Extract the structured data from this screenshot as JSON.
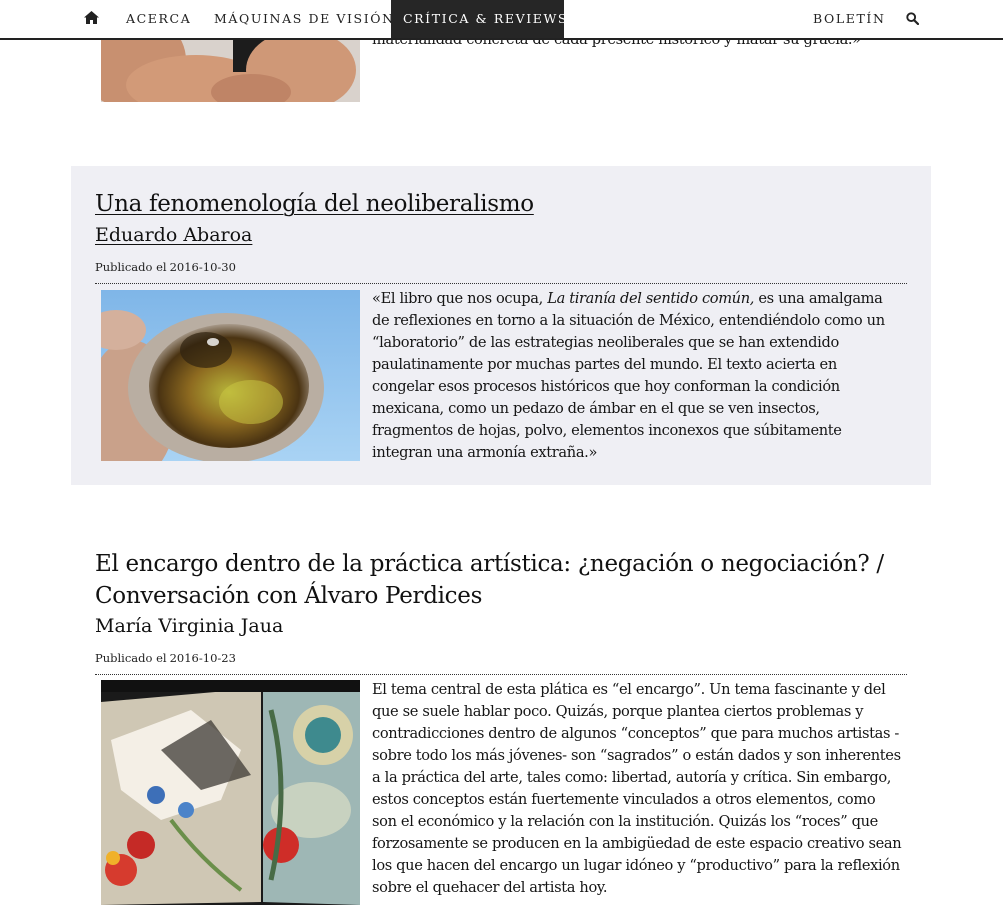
{
  "nav": {
    "items": [
      {
        "label": "ACERCA"
      },
      {
        "label": "MÁQUINAS DE VISIÓN"
      },
      {
        "label": "CRÍTICA & REVIEWS"
      },
      {
        "label": "BOLETÍN"
      }
    ],
    "home_icon": "home-icon",
    "search_icon": "search-icon",
    "active_label": "CRÍTICA & REVIEWS"
  },
  "previous_excerpt": {
    "tail_text": "materialidad concreta de cada presente histórico y matar su gracia.»"
  },
  "articles": [
    {
      "title": "Una fenomenología del neoliberalismo",
      "author": "Eduardo Abaroa",
      "published_prefix": "Publicado el",
      "published_date": "2016-10-30",
      "excerpt_before": "«El libro que nos ocupa, ",
      "excerpt_italic": "La tiranía del sentido común,",
      "excerpt_after": " es una amalgama de reflexiones en torno a la situación de México, entendiéndolo como un “laboratorio” de las estrategias neoliberales que se han extendido paulatinamente por muchas partes del mundo. El texto acierta en congelar esos procesos históricos que hoy conforman la condición mexicana, como un pedazo de ámbar en el que se ven insectos, fragmentos de hojas, polvo, elementos inconexos que súbitamente integran una armonía extraña.»"
    },
    {
      "title_line1": "El encargo dentro de la práctica artística: ¿negación o negociación? /",
      "title_line2": "Conversación con Álvaro Perdices",
      "author": "María Virginia Jaua",
      "published_prefix": "Publicado el",
      "published_date": "2016-10-23",
      "excerpt": "El tema central de esta plática es “el encargo”. Un tema fascinante y del que se suele hablar poco. Quizás, porque plantea ciertos problemas y contradicciones dentro de algunos “conceptos” que para muchos artistas - sobre todo los más jóvenes- son “sagrados” o están dados y son inherentes a la práctica del arte, tales como: libertad, autoría y crítica. Sin embargo, estos conceptos están fuertemente vinculados a otros elementos, como son el económico y la relación con la institución. Quizás los “roces” que forzosamente se producen en la ambigüedad de este espacio creativo sean los que hacen del encargo un lugar idóneo y “productivo” para la reflexión sobre el quehacer del artista hoy."
    }
  ],
  "colors": {
    "nav_active_bg": "#262626",
    "shaded_bg": "#efeff4",
    "text": "#111111"
  }
}
